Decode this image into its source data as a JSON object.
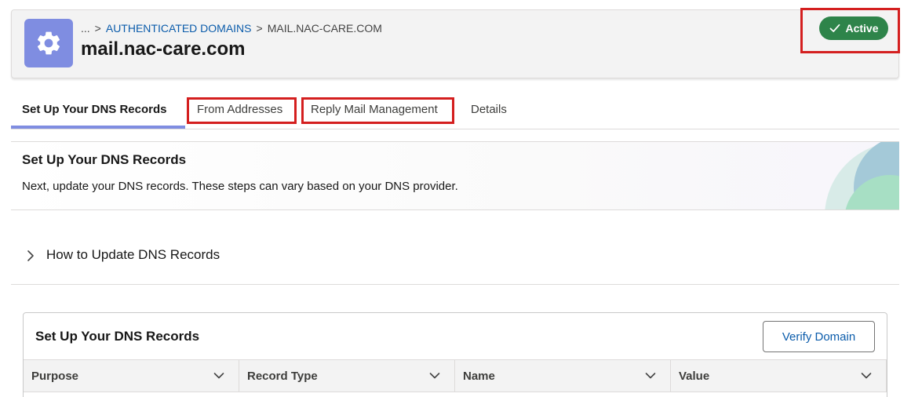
{
  "header": {
    "breadcrumb": {
      "ellipsis": "...",
      "separator": ">",
      "parent": "AUTHENTICATED DOMAINS",
      "current": "MAIL.NAC-CARE.COM"
    },
    "title": "mail.nac-care.com",
    "app_icon": "gear-icon",
    "status": {
      "label": "Active",
      "icon": "check-icon",
      "color": "#2e844a"
    }
  },
  "tabs": [
    {
      "label": "Set Up Your DNS Records",
      "active": true
    },
    {
      "label": "From Addresses",
      "active": false
    },
    {
      "label": "Reply Mail Management",
      "active": false
    },
    {
      "label": "Details",
      "active": false
    }
  ],
  "intro": {
    "title": "Set Up Your DNS Records",
    "description": "Next, update your DNS records. These steps can vary based on your DNS provider."
  },
  "accordion": {
    "label": "How to Update DNS Records",
    "icon": "chevron-right-icon"
  },
  "records": {
    "title": "Set Up Your DNS Records",
    "verify_label": "Verify Domain",
    "columns": [
      "Purpose",
      "Record Type",
      "Name",
      "Value"
    ]
  },
  "colors": {
    "accent": "#7f8de1",
    "link": "#0b5cab",
    "highlight": "#d41f1f"
  }
}
